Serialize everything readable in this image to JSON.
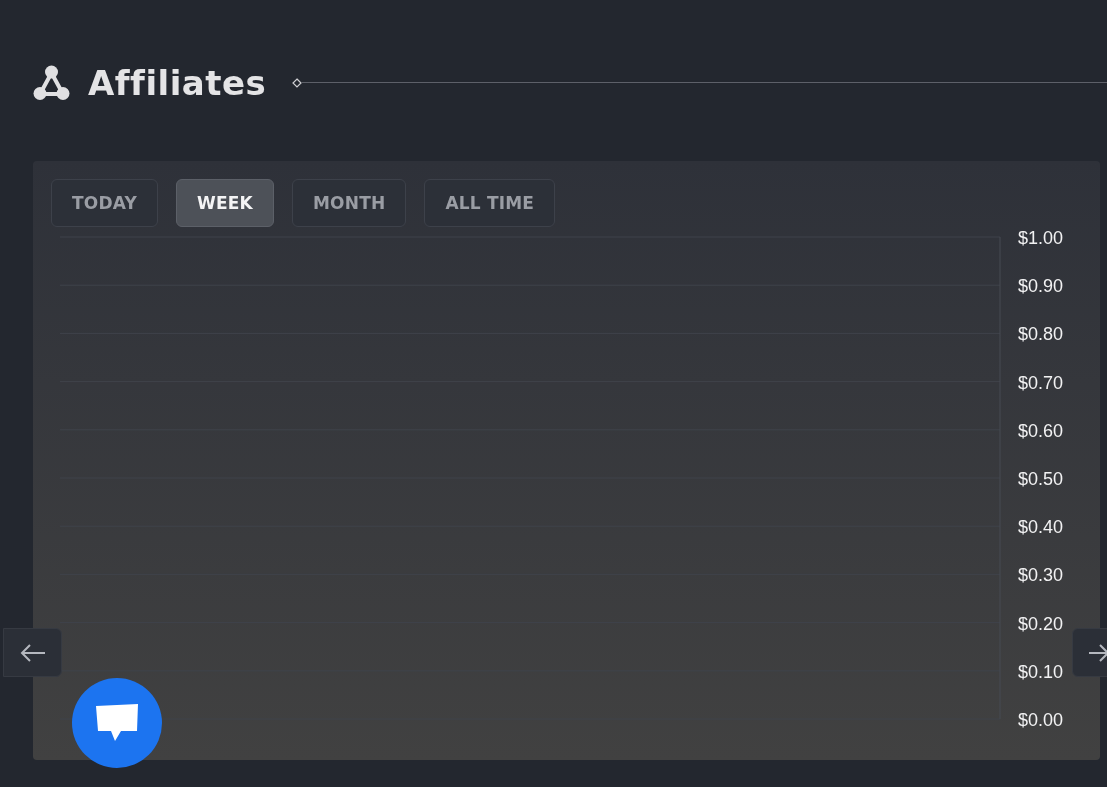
{
  "header": {
    "title": "Affiliates"
  },
  "tabs": [
    {
      "label": "TODAY",
      "selected": false
    },
    {
      "label": "WEEK",
      "selected": true
    },
    {
      "label": "MONTH",
      "selected": false
    },
    {
      "label": "ALL TIME",
      "selected": false
    }
  ],
  "chart": {
    "axis_labels": [
      "$1.00",
      "$0.90",
      "$0.80",
      "$0.70",
      "$0.60",
      "$0.50",
      "$0.40",
      "$0.30",
      "$0.20",
      "$0.10",
      "$0.00"
    ]
  }
}
